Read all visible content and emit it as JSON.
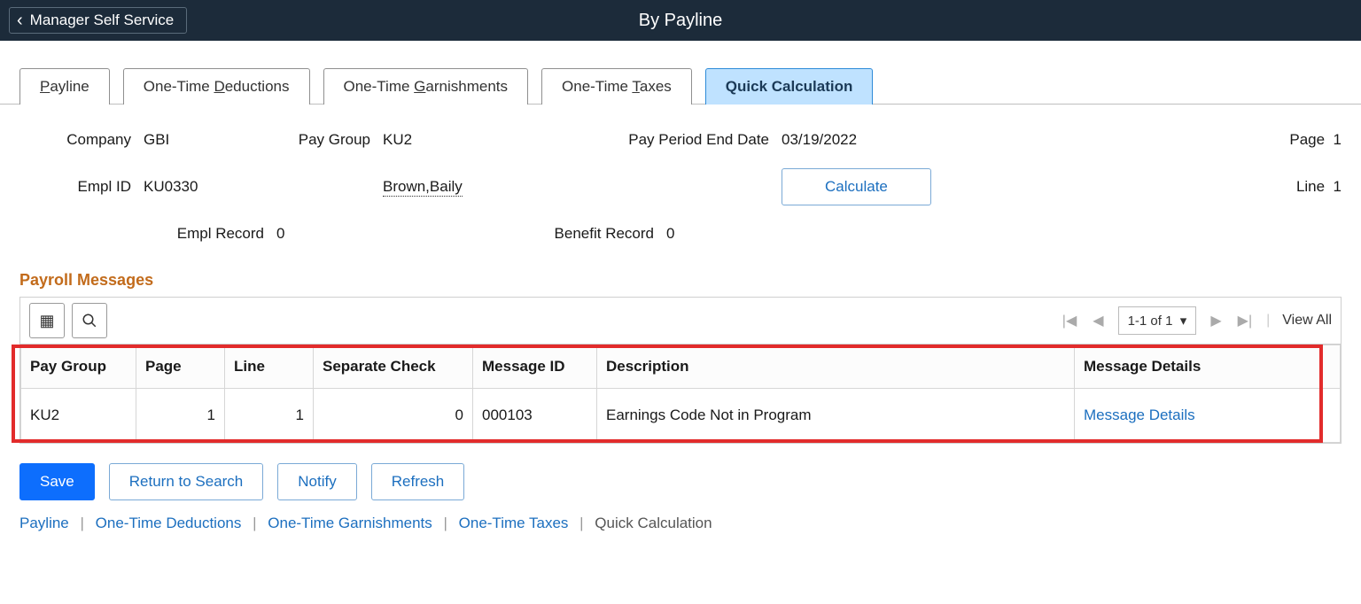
{
  "topbar": {
    "back_label": "Manager Self Service",
    "title": "By Payline"
  },
  "tabs": [
    {
      "label": "Payline",
      "access": "P"
    },
    {
      "label": "One-Time Deductions",
      "access": "D"
    },
    {
      "label": "One-Time Garnishments",
      "access": "G"
    },
    {
      "label": "One-Time Taxes",
      "access": "T"
    },
    {
      "label": "Quick Calculation",
      "access": ""
    }
  ],
  "active_tab_label": "Quick Calculation",
  "header": {
    "company_label": "Company",
    "company_value": "GBI",
    "paygroup_label": "Pay Group",
    "paygroup_value": "KU2",
    "payperiod_label": "Pay Period End Date",
    "payperiod_value": "03/19/2022",
    "page_label": "Page",
    "page_value": "1",
    "emplid_label": "Empl ID",
    "emplid_value": "KU0330",
    "name_value": "Brown,Baily",
    "calculate_label": "Calculate",
    "line_label": "Line",
    "line_value": "1",
    "emplrec_label": "Empl Record",
    "emplrec_value": "0",
    "benrec_label": "Benefit Record",
    "benrec_value": "0"
  },
  "messages": {
    "section_title": "Payroll Messages",
    "page_indicator": "1-1 of 1",
    "view_all": "View All",
    "columns": {
      "paygroup": "Pay Group",
      "page": "Page",
      "line": "Line",
      "sepchk": "Separate Check",
      "msgid": "Message ID",
      "descr": "Description",
      "details": "Message Details"
    },
    "rows": [
      {
        "paygroup": "KU2",
        "page": "1",
        "line": "1",
        "sepchk": "0",
        "msgid": "000103",
        "descr": "Earnings Code Not in Program",
        "details": "Message Details"
      }
    ]
  },
  "footer": {
    "save": "Save",
    "return": "Return to Search",
    "notify": "Notify",
    "refresh": "Refresh"
  },
  "bottom_links": {
    "payline": "Payline",
    "deductions": "One-Time Deductions",
    "garnishments": "One-Time Garnishments",
    "taxes": "One-Time Taxes",
    "quickcalc": "Quick Calculation"
  }
}
